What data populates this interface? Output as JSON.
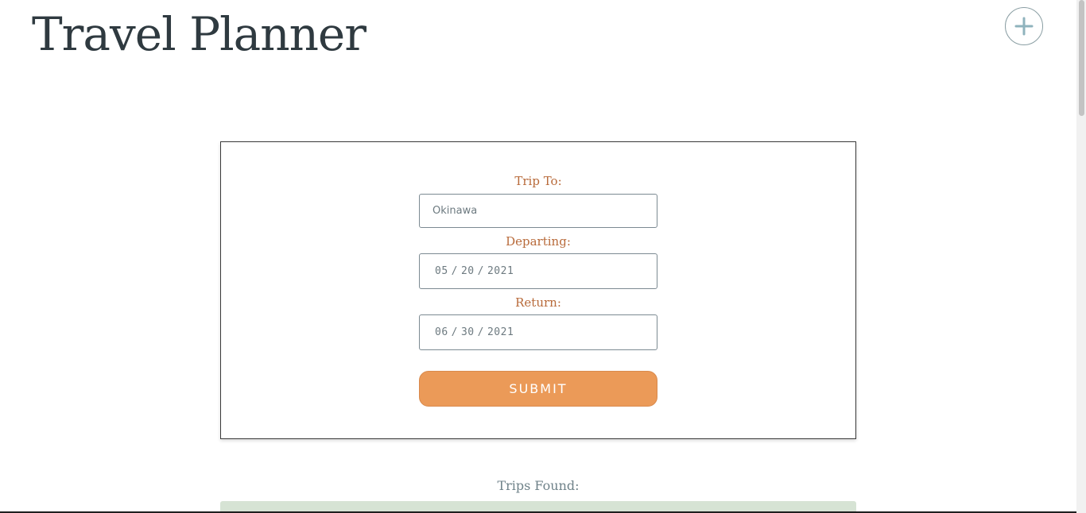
{
  "header": {
    "title": "Travel Planner",
    "add_icon": "plus-icon"
  },
  "form": {
    "trip_to": {
      "label": "Trip To:",
      "value": "Okinawa"
    },
    "departing": {
      "label": "Departing:",
      "month": "05",
      "day": "20",
      "year": "2021"
    },
    "return": {
      "label": "Return:",
      "month": "06",
      "day": "30",
      "year": "2021"
    },
    "submit_label": "SUBMIT"
  },
  "results": {
    "heading": "Trips Found:"
  },
  "colors": {
    "accent": "#eb9a58",
    "label": "#b86a3a",
    "title": "#2f3a40",
    "result_bar": "#d6e3d4"
  }
}
